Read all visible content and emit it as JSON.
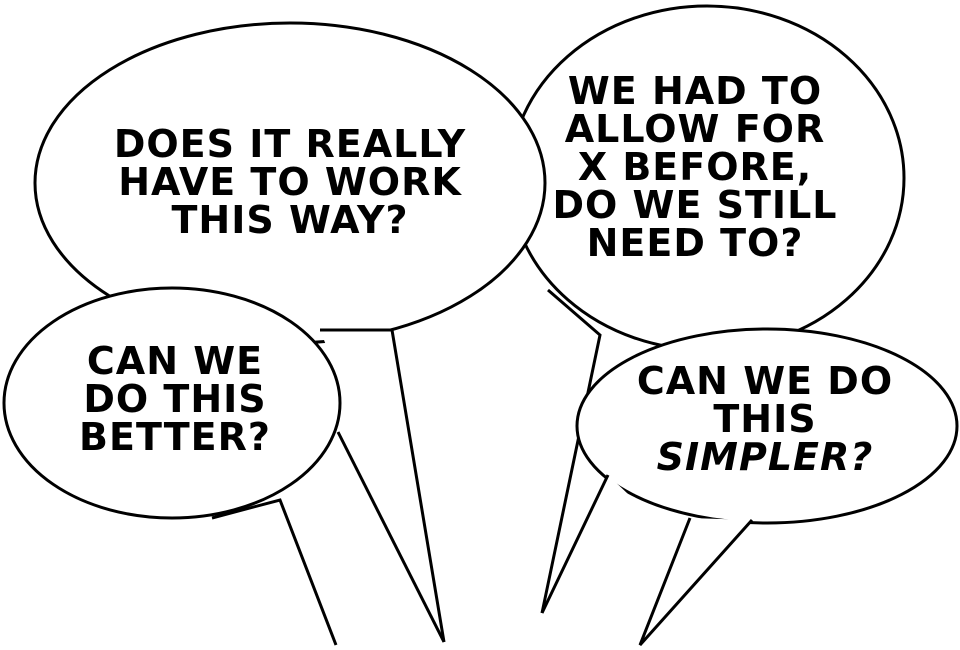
{
  "colors": {
    "stroke": "#000000",
    "fill": "#ffffff",
    "text": "#000000"
  },
  "bubbles": [
    {
      "id": "top-left",
      "lines": [
        "DOES IT REALLY",
        "HAVE TO WORK",
        "THIS WAY?"
      ]
    },
    {
      "id": "top-right",
      "lines": [
        "WE HAD TO",
        "ALLOW FOR",
        "X BEFORE,",
        "DO WE STILL",
        "NEED TO?"
      ]
    },
    {
      "id": "bottom-left",
      "lines": [
        "CAN WE",
        "DO THIS",
        "BETTER?"
      ]
    },
    {
      "id": "bottom-right",
      "lines": [
        "CAN WE DO",
        "THIS"
      ],
      "emphasis": "SIMPLER?"
    }
  ]
}
